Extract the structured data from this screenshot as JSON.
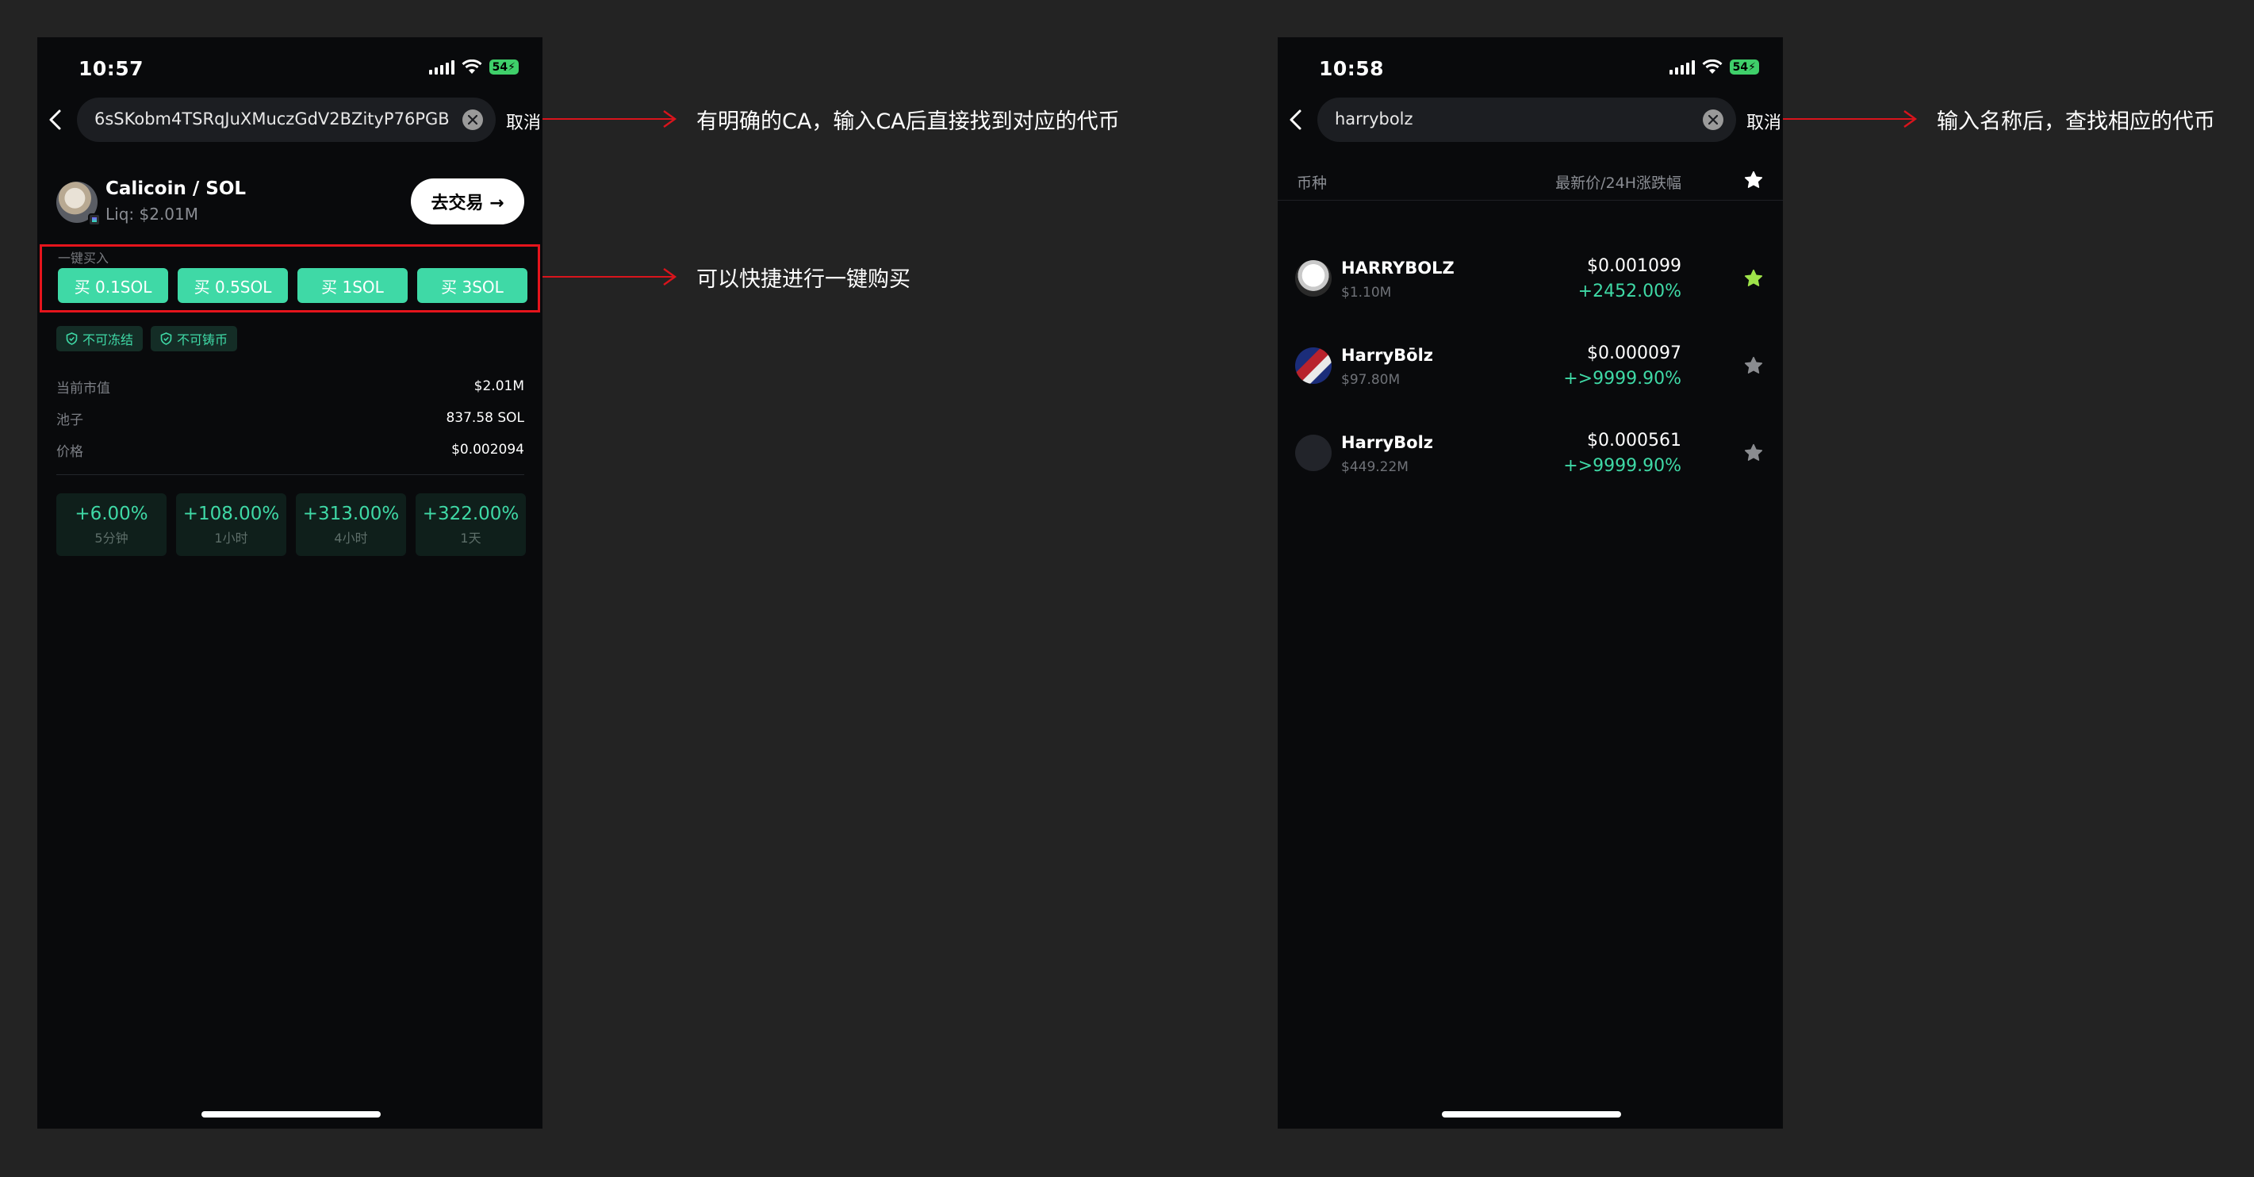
{
  "left_screen": {
    "status_time": "10:57",
    "battery": "54",
    "search_value": "6sSKobm4TSRqJuXMuczGdV2BZityP76PGB",
    "cancel_label": "取消",
    "pair_name": "Calicoin / SOL",
    "liquidity": "Liq: $2.01M",
    "trade_button": "去交易 →",
    "quick_buy_label": "一键买入",
    "buy_buttons": [
      "买 0.1SOL",
      "买 0.5SOL",
      "买 1SOL",
      "买 3SOL"
    ],
    "badges": [
      "不可冻结",
      "不可铸币"
    ],
    "stats": [
      {
        "label": "当前市值",
        "value": "$2.01M"
      },
      {
        "label": "池子",
        "value": "837.58 SOL"
      },
      {
        "label": "价格",
        "value": "$0.002094"
      }
    ],
    "changes": [
      {
        "value": "+6.00%",
        "period": "5分钟"
      },
      {
        "value": "+108.00%",
        "period": "1小时"
      },
      {
        "value": "+313.00%",
        "period": "4小时"
      },
      {
        "value": "+322.00%",
        "period": "1天"
      }
    ]
  },
  "right_screen": {
    "status_time": "10:58",
    "battery": "54",
    "search_value": "harrybolz",
    "cancel_label": "取消",
    "header_coin": "币种",
    "header_price": "最新价/24H涨跌幅",
    "coins": [
      {
        "name": "HARRYBOLZ",
        "market_cap": "$1.10M",
        "price": "$0.001099",
        "change": "+2452.00%",
        "favorited": true
      },
      {
        "name": "HarryBōlz",
        "market_cap": "$97.80M",
        "price": "$0.000097",
        "change": "+>9999.90%",
        "favorited": false
      },
      {
        "name": "HarryBolz",
        "market_cap": "$449.22M",
        "price": "$0.000561",
        "change": "+>9999.90%",
        "favorited": false
      }
    ]
  },
  "annotations": [
    "有明确的CA，输入CA后直接找到对应的代币",
    "可以快捷进行一键购买",
    "输入名称后，查找相应的代币"
  ],
  "colors": {
    "accent_green": "#3fd9a6",
    "annotation_red": "#d9141c",
    "favorite_star": "#9ee24a",
    "background": "#232323",
    "phone_bg": "#090a0c"
  }
}
